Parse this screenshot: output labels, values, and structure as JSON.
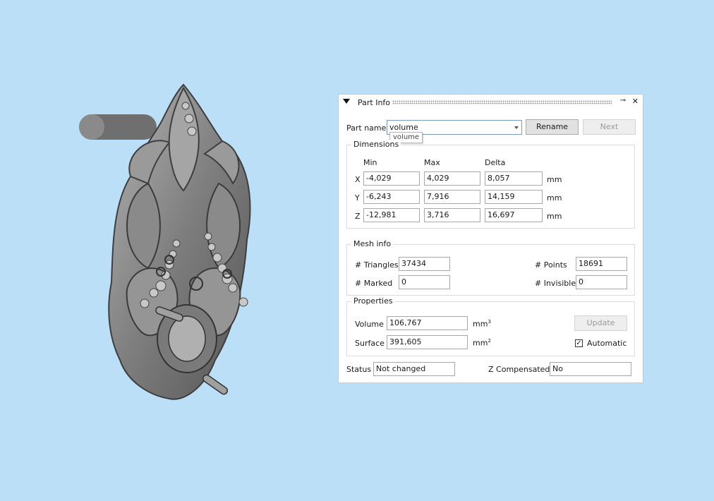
{
  "panel": {
    "title": "Part Info",
    "part_name_label": "Part name",
    "part_name_value": "volume",
    "part_name_tooltip": "volume",
    "rename_label": "Rename",
    "next_label": "Next"
  },
  "dimensions": {
    "title": "Dimensions",
    "headers": [
      "Min",
      "Max",
      "Delta"
    ],
    "unit": "mm",
    "rows": [
      {
        "axis": "X",
        "min": "-4,029",
        "max": "4,029",
        "delta": "8,057"
      },
      {
        "axis": "Y",
        "min": "-6,243",
        "max": "7,916",
        "delta": "14,159"
      },
      {
        "axis": "Z",
        "min": "-12,981",
        "max": "3,716",
        "delta": "16,697"
      }
    ]
  },
  "mesh_info": {
    "title": "Mesh info",
    "triangles_label": "# Triangles",
    "triangles": "37434",
    "points_label": "# Points",
    "points": "18691",
    "marked_label": "# Marked",
    "marked": "0",
    "invisible_label": "# Invisible",
    "invisible": "0"
  },
  "properties": {
    "title": "Properties",
    "volume_label": "Volume",
    "volume": "106,767",
    "volume_unit": "mm",
    "surface_label": "Surface",
    "surface": "391,605",
    "surface_unit": "mm",
    "update_label": "Update",
    "automatic_label": "Automatic",
    "automatic_checked": true
  },
  "status": {
    "status_label": "Status",
    "status_value": "Not changed",
    "zcomp_label": "Z Compensated",
    "zcomp_value": "No"
  },
  "colors": {
    "background": "#bcdff8",
    "model": "#8c8c8c"
  }
}
